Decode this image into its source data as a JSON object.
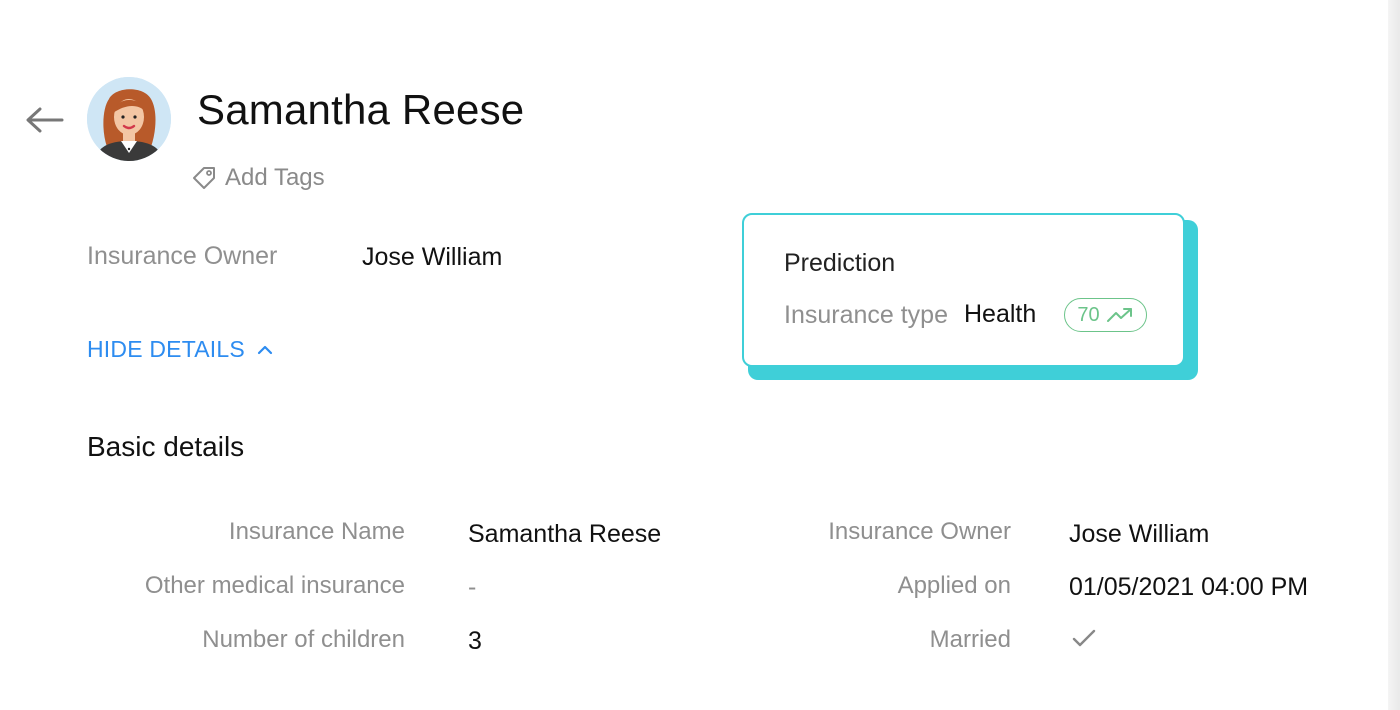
{
  "header": {
    "name": "Samantha Reese",
    "add_tags_label": "Add Tags"
  },
  "icons": {
    "back": "arrow-left-icon",
    "tag": "tag-icon",
    "chevron": "chevron-up-icon",
    "trend": "trending-up-icon",
    "check": "check-icon"
  },
  "summary": {
    "owner_label": "Insurance Owner",
    "owner_value": "Jose William",
    "toggle_label": "HIDE DETAILS"
  },
  "prediction": {
    "title": "Prediction",
    "label": "Insurance type",
    "value": "Health",
    "score": "70"
  },
  "basic_details": {
    "title": "Basic details",
    "left": [
      {
        "label": "Insurance Name",
        "value": "Samantha Reese"
      },
      {
        "label": "Other medical insurance",
        "value": "-"
      },
      {
        "label": "Number of children",
        "value": "3"
      }
    ],
    "right": [
      {
        "label": "Insurance Owner",
        "value": "Jose William"
      },
      {
        "label": "Applied on",
        "value": "01/05/2021 04:00 PM"
      },
      {
        "label": "Married",
        "value": ""
      }
    ]
  },
  "colors": {
    "accent_link": "#2d8cf0",
    "card_border": "#3fcfd8",
    "score_green": "#6cc48a",
    "label_gray": "#8f8f8f"
  }
}
